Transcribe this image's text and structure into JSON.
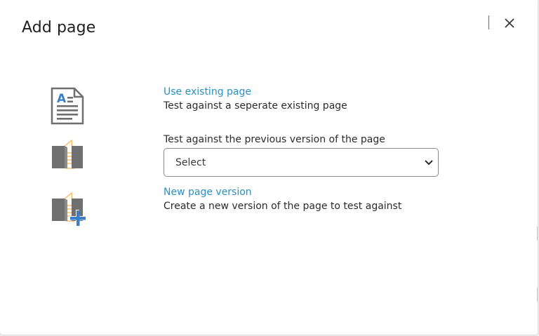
{
  "dialog": {
    "title": "Add page",
    "close_icon": "close-icon"
  },
  "options": [
    {
      "icon": "document-icon",
      "link": "Use existing page",
      "description": "Test against a seperate existing page"
    },
    {
      "icon": "book-icon",
      "label": "Test against the previous version of the page",
      "select": {
        "value": "Select",
        "chevron_icon": "chevron-down-icon"
      }
    },
    {
      "icon": "book-add-icon",
      "link": "New page version",
      "description": "Create a new version of the page to test against"
    }
  ],
  "colors": {
    "link": "#2a8fc1",
    "icon_gray": "#6f6f6f",
    "accent_blue": "#3a7ec8",
    "accent_orange": "#f2b35a"
  }
}
